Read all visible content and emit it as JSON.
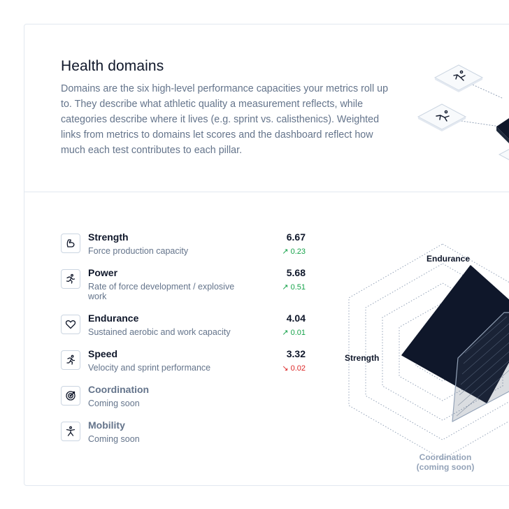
{
  "header": {
    "title": "Health domains",
    "description": "Domains are the six high-level performance capacities your metrics roll up to. They describe what athletic quality a measurement reflects, while categories describe where it lives (e.g. sprint vs. calisthenics). Weighted links from metrics to domains let scores and the dashboard reflect how much each test contributes to each pillar."
  },
  "domains": [
    {
      "name": "Strength",
      "subtitle": "Force production capacity",
      "score": "6.67",
      "delta": "0.23",
      "trend": "up",
      "icon": "flexed-bicep-icon"
    },
    {
      "name": "Power",
      "subtitle": "Rate of force development / explosive work",
      "score": "5.68",
      "delta": "0.51",
      "trend": "up",
      "icon": "runner-icon"
    },
    {
      "name": "Endurance",
      "subtitle": "Sustained aerobic and work capacity",
      "score": "4.04",
      "delta": "0.01",
      "trend": "up",
      "icon": "heart-icon"
    },
    {
      "name": "Speed",
      "subtitle": "Velocity and sprint performance",
      "score": "3.32",
      "delta": "0.02",
      "trend": "down",
      "icon": "sprinter-icon"
    },
    {
      "name": "Coordination",
      "subtitle": "Coming soon",
      "icon": "target-icon"
    },
    {
      "name": "Mobility",
      "subtitle": "Coming soon",
      "icon": "stretch-icon"
    }
  ],
  "radar": {
    "label_endurance": "Endurance",
    "label_strength": "Strength",
    "label_coordination_1": "Coordination",
    "label_coordination_2": "(coming soon)",
    "label_partial": "("
  },
  "colors": {
    "accent": "#0f172a",
    "up": "#16a34a",
    "down": "#dc2626",
    "muted": "#64748b"
  }
}
